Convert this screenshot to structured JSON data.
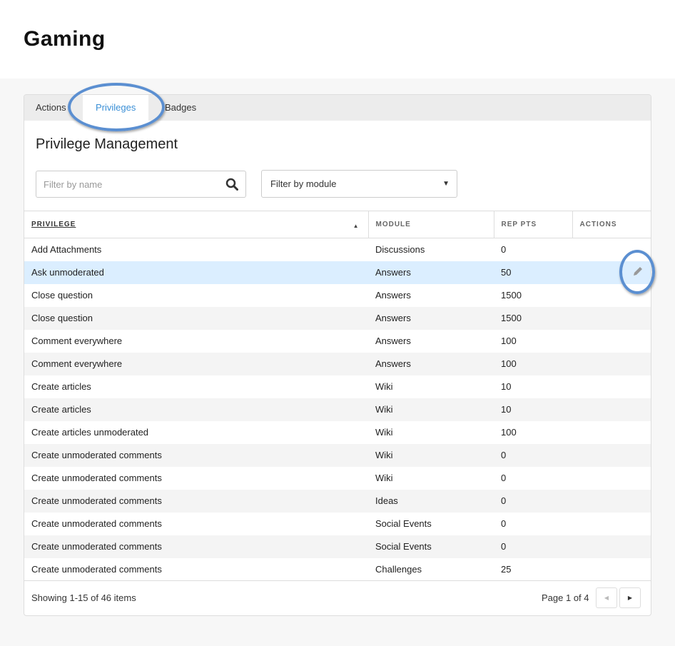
{
  "page": {
    "title": "Gaming"
  },
  "tabs": [
    "Actions",
    "Privileges",
    "Badges"
  ],
  "section_title": "Privilege Management",
  "filters": {
    "name_placeholder": "Filter by name",
    "module_selected": "Filter by module"
  },
  "table": {
    "headers": [
      "PRIVILEGE",
      "MODULE",
      "REP PTS",
      "ACTIONS"
    ],
    "rows": [
      [
        "Add Attachments",
        "Discussions",
        "0"
      ],
      [
        "Ask unmoderated",
        "Answers",
        "50"
      ],
      [
        "Close question",
        "Answers",
        "1500"
      ],
      [
        "Close question",
        "Answers",
        "1500"
      ],
      [
        "Comment everywhere",
        "Answers",
        "100"
      ],
      [
        "Comment everywhere",
        "Answers",
        "100"
      ],
      [
        "Create articles",
        "Wiki",
        "10"
      ],
      [
        "Create articles",
        "Wiki",
        "10"
      ],
      [
        "Create articles unmoderated",
        "Wiki",
        "100"
      ],
      [
        "Create unmoderated comments",
        "Wiki",
        "0"
      ],
      [
        "Create unmoderated comments",
        "Wiki",
        "0"
      ],
      [
        "Create unmoderated comments",
        "Ideas",
        "0"
      ],
      [
        "Create unmoderated comments",
        "Social Events",
        "0"
      ],
      [
        "Create unmoderated comments",
        "Social Events",
        "0"
      ],
      [
        "Create unmoderated comments",
        "Challenges",
        "25"
      ]
    ]
  },
  "footer": {
    "showing": "Showing 1-15 of 46 items",
    "page": "Page 1 of 4"
  }
}
